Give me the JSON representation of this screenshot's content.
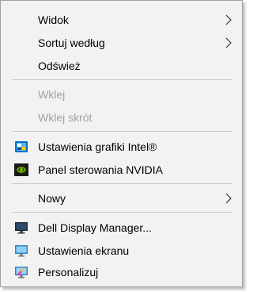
{
  "context_menu": {
    "items": [
      {
        "label": "Widok",
        "submenu": true,
        "enabled": true
      },
      {
        "label": "Sortuj według",
        "submenu": true,
        "enabled": true
      },
      {
        "label": "Odśwież",
        "enabled": true
      },
      {
        "label": "Wklej",
        "enabled": false
      },
      {
        "label": "Wklej skrót",
        "enabled": false
      },
      {
        "label": "Ustawienia grafiki Intel®",
        "icon": "intel-graphics-icon",
        "enabled": true
      },
      {
        "label": "Panel sterowania NVIDIA",
        "icon": "nvidia-icon",
        "enabled": true
      },
      {
        "label": "Nowy",
        "submenu": true,
        "enabled": true
      },
      {
        "label": "Dell Display Manager...",
        "icon": "monitor-icon",
        "enabled": true
      },
      {
        "label": "Ustawienia ekranu",
        "icon": "display-settings-icon",
        "enabled": true
      },
      {
        "label": "Personalizuj",
        "icon": "personalize-icon",
        "enabled": true
      }
    ]
  },
  "colors": {
    "menu_background": "#f2f2f2",
    "border": "#a0a0a0",
    "separator": "#c8c8c8",
    "disabled_text": "#a0a0a0",
    "nvidia_green": "#76b900",
    "intel_blue": "#0071c5"
  }
}
